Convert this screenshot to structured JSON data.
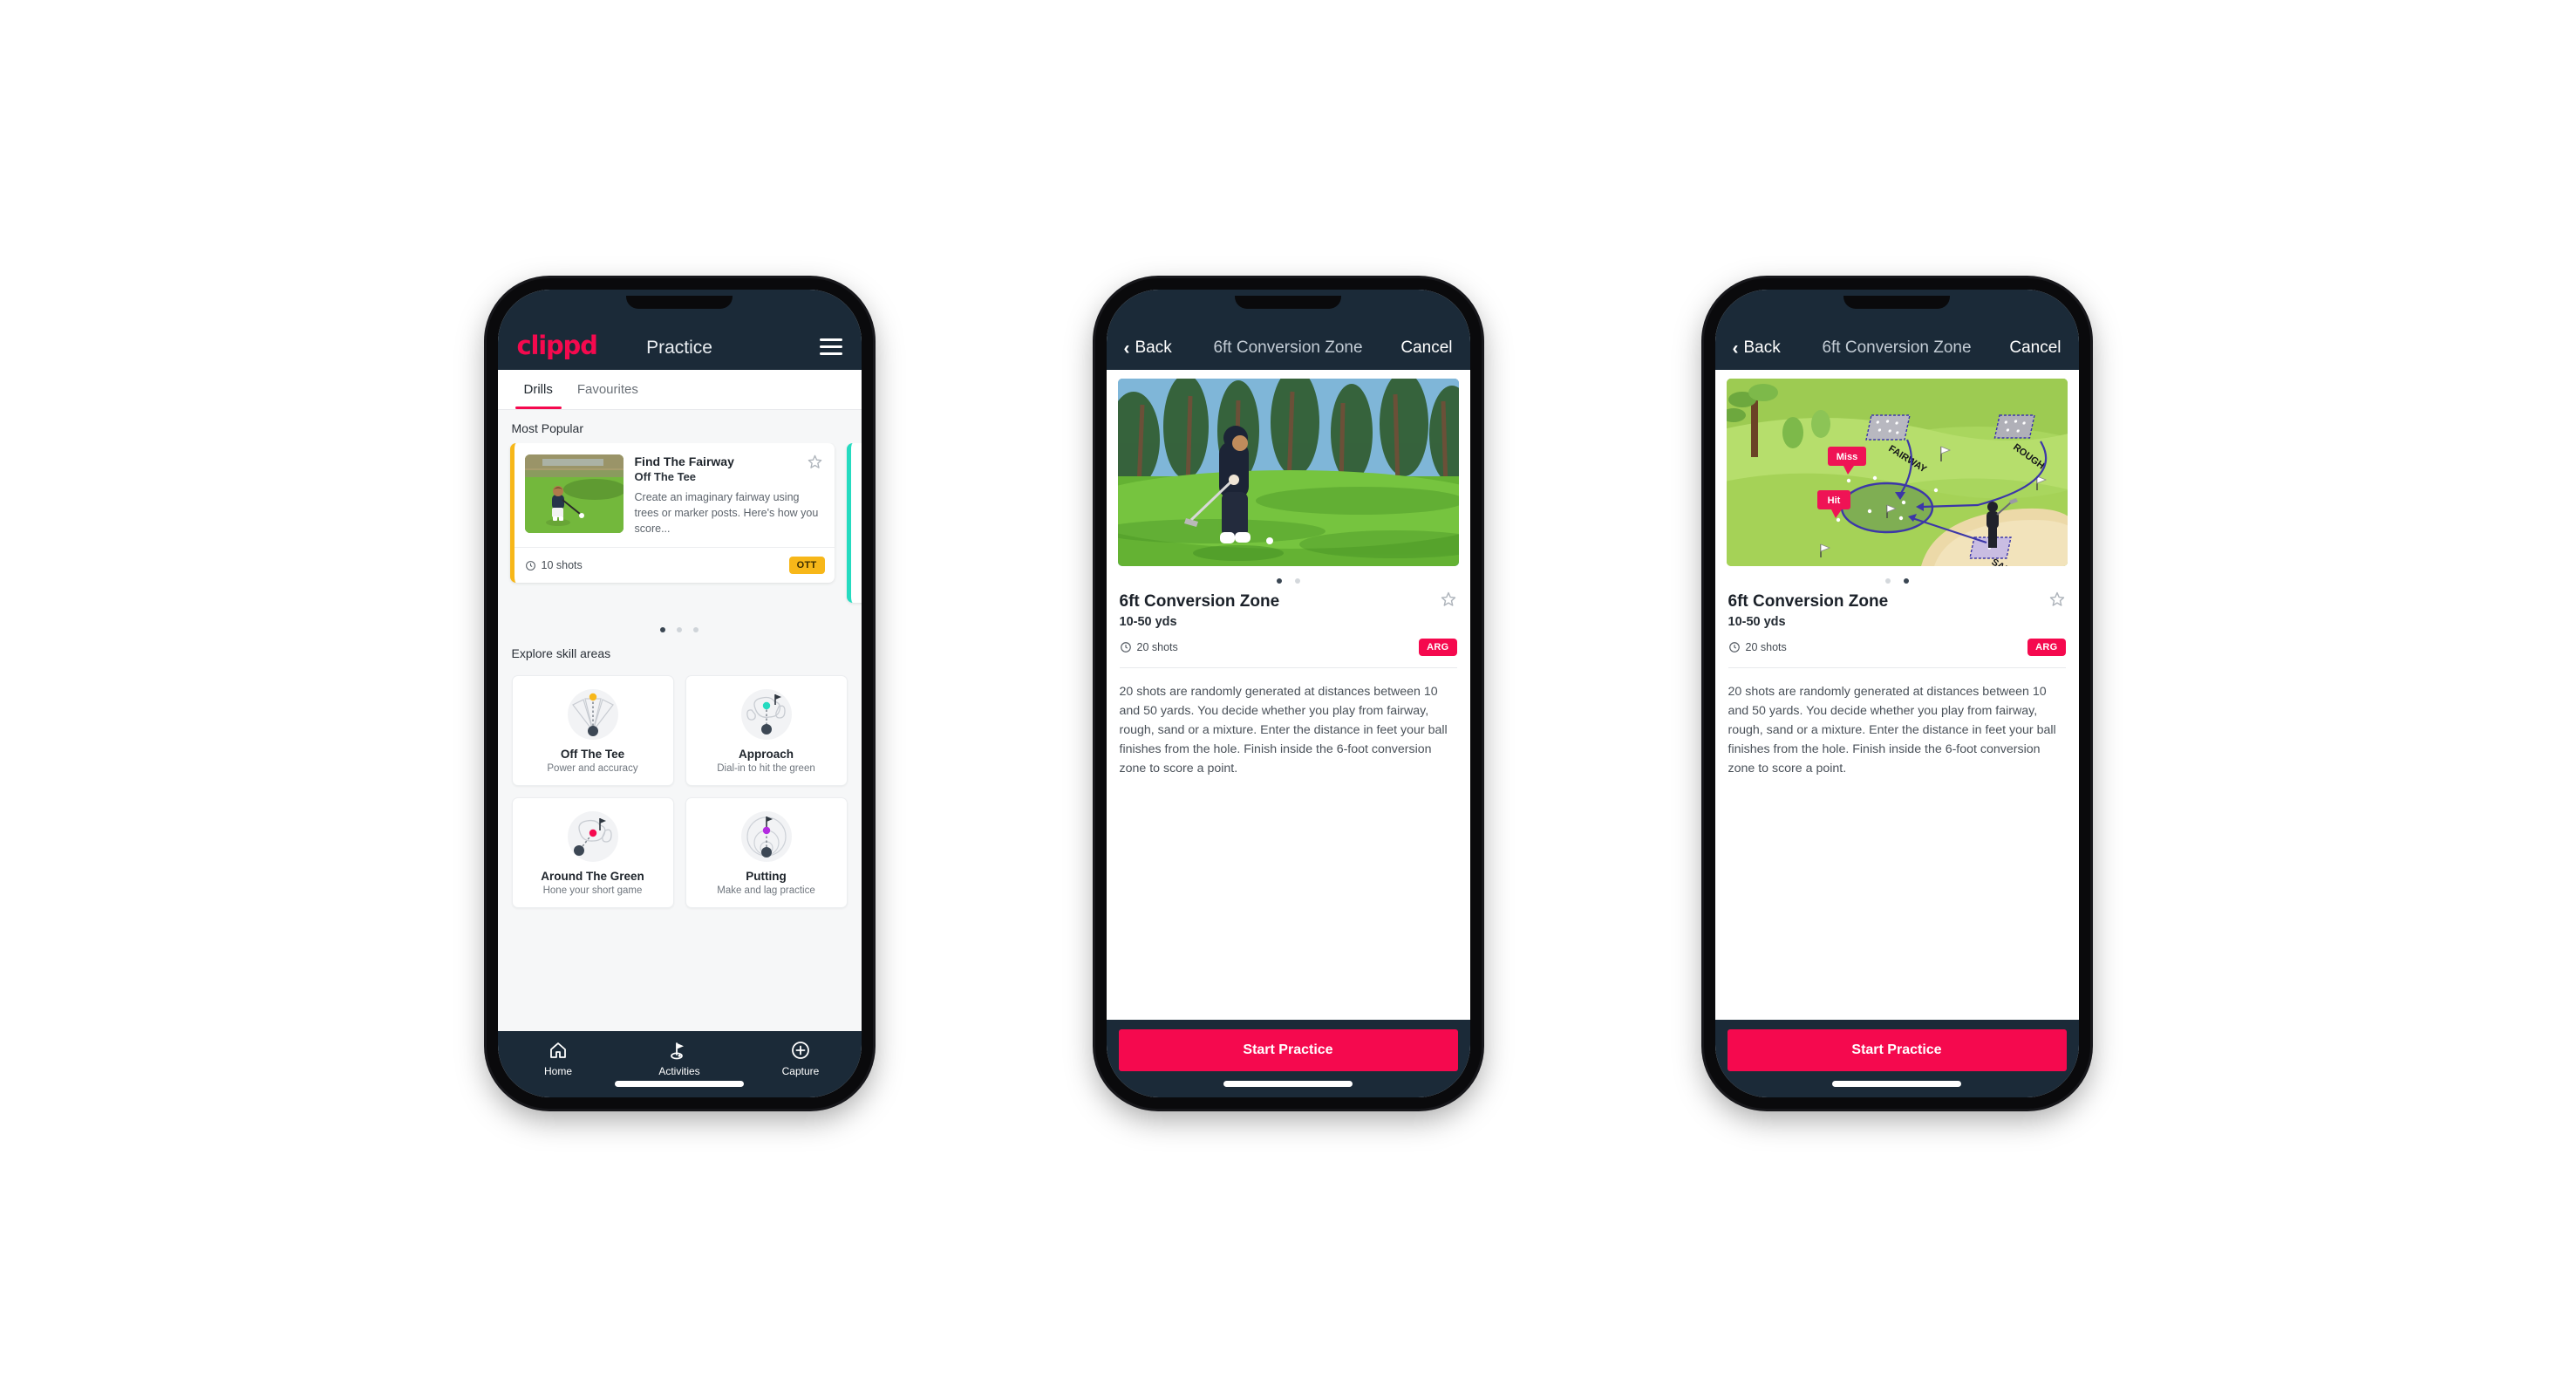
{
  "brand": "clippd",
  "phone1": {
    "appbar": {
      "title": "Practice",
      "menu_icon": "hamburger-menu-icon"
    },
    "tabs": [
      {
        "label": "Drills",
        "active": true
      },
      {
        "label": "Favourites",
        "active": false
      }
    ],
    "most_popular": {
      "section_title": "Most Popular",
      "card": {
        "title": "Find The Fairway",
        "subtitle": "Off The Tee",
        "description": "Create an imaginary fairway using trees or marker posts. Here's how you score...",
        "shots": "10 shots",
        "badge": "OTT",
        "accent_color": "#f7b719",
        "star_icon": "star-outline-icon",
        "clock_icon": "clock-icon"
      },
      "peek_accent_color": "#25dbc0",
      "dots": {
        "count": 3,
        "active": 0
      }
    },
    "skills": {
      "section_title": "Explore skill areas",
      "tiles": [
        {
          "title": "Off The Tee",
          "subtitle": "Power and accuracy",
          "icon": "tee-shot-dispersion-icon",
          "dot_color": "#f7b719"
        },
        {
          "title": "Approach",
          "subtitle": "Dial-in to hit the green",
          "icon": "approach-green-icon",
          "dot_color": "#25dbc0"
        },
        {
          "title": "Around The Green",
          "subtitle": "Hone your short game",
          "icon": "chip-around-green-icon",
          "dot_color": "#f5094e"
        },
        {
          "title": "Putting",
          "subtitle": "Make and lag practice",
          "icon": "putting-rings-icon",
          "dot_color": "#b32ce0"
        }
      ]
    },
    "bottom_nav": [
      {
        "label": "Home",
        "icon": "home-icon",
        "active": false
      },
      {
        "label": "Activities",
        "icon": "golf-flag-icon",
        "active": true
      },
      {
        "label": "Capture",
        "icon": "plus-circle-icon",
        "active": false
      }
    ]
  },
  "phone2": {
    "navbar": {
      "back_label": "Back",
      "back_icon": "chevron-left-icon",
      "title": "6ft Conversion Zone",
      "cancel_label": "Cancel"
    },
    "hero_media": "golfer-chipping-photo",
    "dots": {
      "count": 2,
      "active": 0
    },
    "title": "6ft Conversion Zone",
    "subtitle": "10-50 yds",
    "shots": "20 shots",
    "badge": "ARG",
    "star_icon": "star-outline-icon",
    "clock_icon": "clock-icon",
    "description": "20 shots are randomly generated at distances between 10 and 50 yards. You decide whether you play from fairway, rough, sand or a mixture. Enter the distance in feet your ball finishes from the hole. Finish inside the 6-foot conversion zone to score a point.",
    "cta": "Start Practice"
  },
  "phone3": {
    "navbar": {
      "back_label": "Back",
      "back_icon": "chevron-left-icon",
      "title": "6ft Conversion Zone",
      "cancel_label": "Cancel"
    },
    "hero_media": "golf-course-diagram",
    "diagram_labels": {
      "fairway": "FAIRWAY",
      "rough": "ROUGH",
      "sand": "SAND",
      "miss": "Miss",
      "hit": "Hit"
    },
    "dots": {
      "count": 2,
      "active": 1
    },
    "title": "6ft Conversion Zone",
    "subtitle": "10-50 yds",
    "shots": "20 shots",
    "badge": "ARG",
    "star_icon": "star-outline-icon",
    "clock_icon": "clock-icon",
    "description": "20 shots are randomly generated at distances between 10 and 50 yards. You decide whether you play from fairway, rough, sand or a mixture. Enter the distance in feet your ball finishes from the hole. Finish inside the 6-foot conversion zone to score a point.",
    "cta": "Start Practice"
  },
  "colors": {
    "brand_pink": "#f5094e",
    "navy": "#1b2a38",
    "amber": "#f7b719",
    "teal": "#25dbc0"
  }
}
